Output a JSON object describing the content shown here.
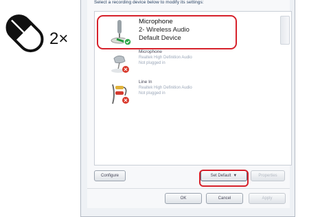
{
  "hint": {
    "click_count": "2×",
    "icon": "mouse-icon"
  },
  "dialog": {
    "instruction": "Select a recording device below to modify its settings:",
    "devices": [
      {
        "name": "Microphone",
        "line2": "2- Wireless Audio",
        "line3": "Default Device",
        "icon": "microphone-icon",
        "selected": true
      },
      {
        "name": "Microphone",
        "line2": "Realtek High Definition Audio",
        "line3": "Not plugged in",
        "icon": "microphone-icon",
        "selected": false
      },
      {
        "name": "Line In",
        "line2": "Realtek High Definition Audio",
        "line3": "Not plugged in",
        "icon": "line-in-icon",
        "selected": false
      }
    ],
    "buttons": {
      "configure": "Configure",
      "set_default": "Set Default",
      "properties": "Properties",
      "ok": "OK",
      "cancel": "Cancel",
      "apply": "Apply"
    }
  },
  "colors": {
    "highlight": "#d6202a",
    "dialog_bg": "#eef1f5"
  }
}
